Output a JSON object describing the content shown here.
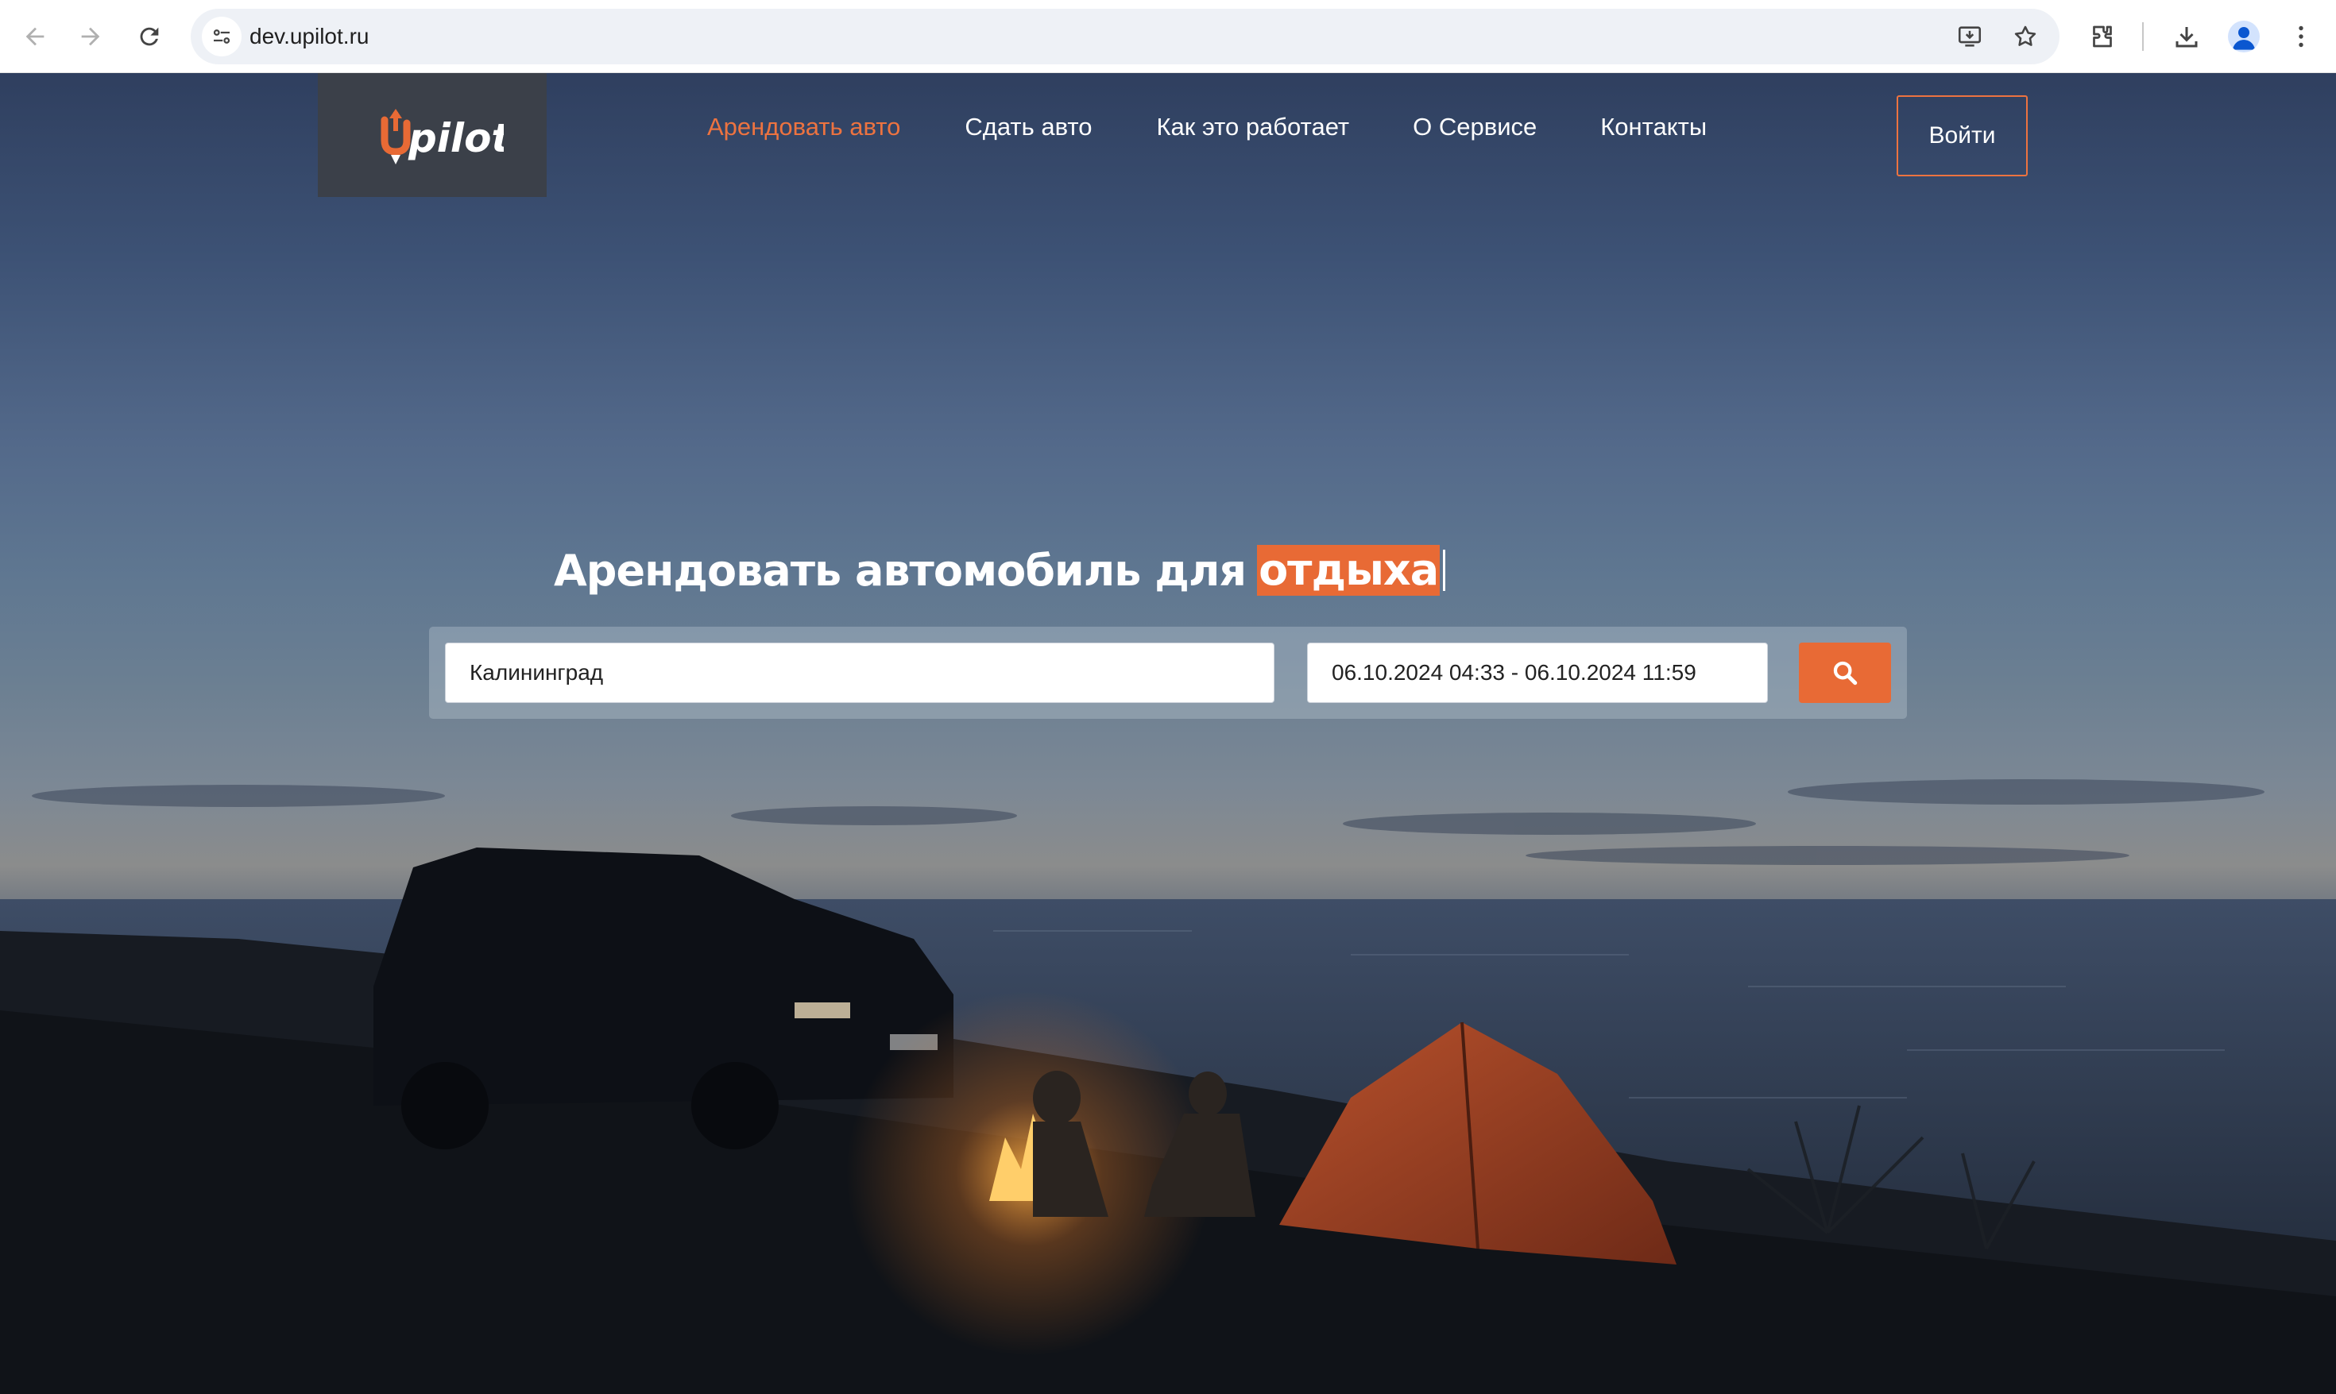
{
  "browser": {
    "url": "dev.upilot.ru"
  },
  "header": {
    "logo_text": "Upilot",
    "nav": [
      {
        "label": "Арендовать авто",
        "active": true
      },
      {
        "label": "Сдать авто",
        "active": false
      },
      {
        "label": "Как это работает",
        "active": false
      },
      {
        "label": "О Сервисе",
        "active": false
      },
      {
        "label": "Контакты",
        "active": false
      }
    ],
    "login_label": "Войти"
  },
  "hero": {
    "title_prefix": "Арендовать автомобиль для",
    "title_highlight": "отдыха"
  },
  "search": {
    "city_value": "Калининград",
    "dates_value": "06.10.2024 04:33 - 06.10.2024 11:59",
    "button_icon": "search-icon"
  },
  "colors": {
    "accent": "#e86a35",
    "nav_active": "#ed7340",
    "logo_bg": "#3b4049"
  }
}
